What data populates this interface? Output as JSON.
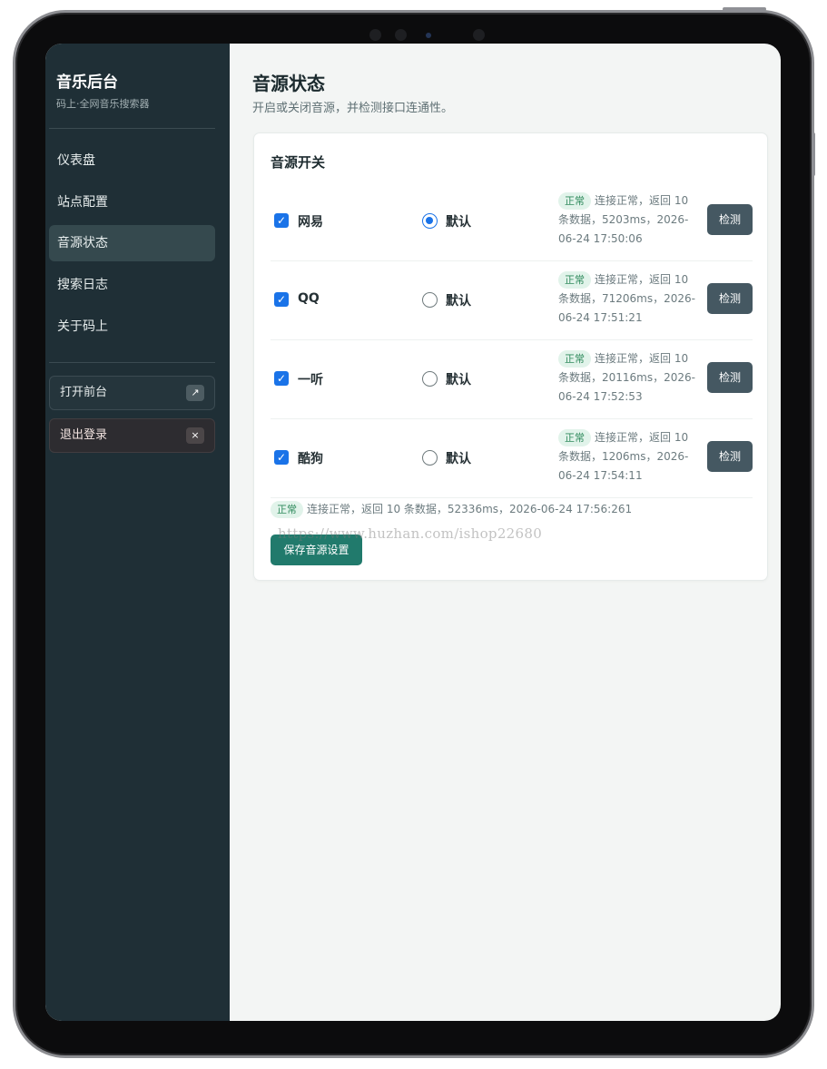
{
  "sidebar": {
    "title": "音乐后台",
    "subtitle": "码上·全网音乐搜索器",
    "nav": [
      {
        "label": "仪表盘",
        "active": false
      },
      {
        "label": "站点配置",
        "active": false
      },
      {
        "label": "音源状态",
        "active": true
      },
      {
        "label": "搜索日志",
        "active": false
      },
      {
        "label": "关于码上",
        "active": false
      }
    ],
    "open_frontend": {
      "label": "打开前台",
      "icon": "↗"
    },
    "logout": {
      "label": "退出登录",
      "icon": "×"
    }
  },
  "main": {
    "title": "音源状态",
    "subtitle": "开启或关闭音源，并检测接口连通性。",
    "card_title": "音源开关",
    "default_label": "默认",
    "check_label": "检测",
    "badge_label": "正常",
    "sources": [
      {
        "name": "网易",
        "enabled": true,
        "is_default": true,
        "status_line1": "连接正常，返回 10",
        "status_line2": "条数据，5203ms，2026-",
        "status_line3": "06-24 17:50:06"
      },
      {
        "name": "QQ",
        "enabled": true,
        "is_default": false,
        "status_line1": "连接正常，返回 10",
        "status_line2": "条数据，71206ms，2026-",
        "status_line3": "06-24 17:51:21"
      },
      {
        "name": "一听",
        "enabled": true,
        "is_default": false,
        "status_line1": "连接正常，返回 10",
        "status_line2": "条数据，20116ms，2026-",
        "status_line3": "06-24 17:52:53"
      },
      {
        "name": "酷狗",
        "enabled": true,
        "is_default": false,
        "status_line1": "连接正常，返回 10",
        "status_line2": "条数据，1206ms，2026-",
        "status_line3": "06-24 17:54:11"
      }
    ],
    "summary_text": "连接正常，返回 10 条数据，52336ms，2026-06-24 17:56:261",
    "save_label": "保存音源设置",
    "watermark": "https://www.huzhan.com/ishop22680"
  },
  "colors": {
    "sidebar_bg": "#1f2f36",
    "active_nav": "#35494e",
    "accent_blue": "#1a73e8",
    "save_green": "#217a6c",
    "check_btn": "#455862",
    "badge_bg": "#e1f3ea",
    "badge_text": "#2f8a5c"
  }
}
